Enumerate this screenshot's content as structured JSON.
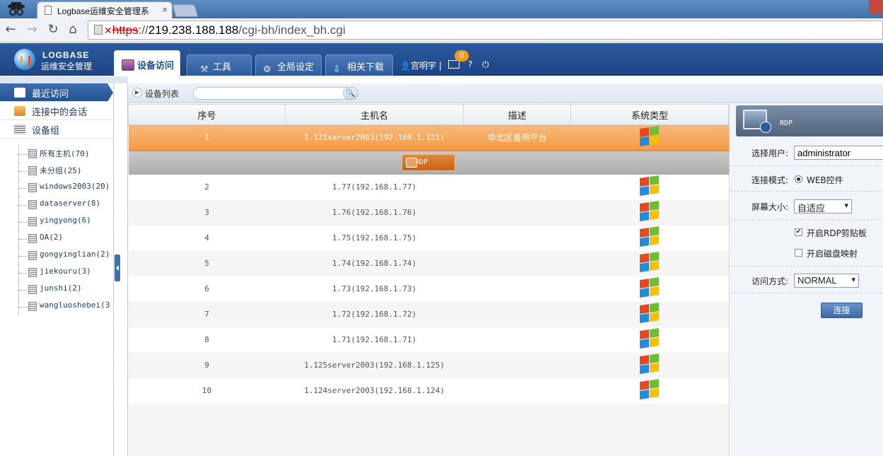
{
  "browser": {
    "tab_title": "Logbase运维安全管理系",
    "url_scheme": "https",
    "url_host": "219.238.188.188",
    "url_path": "/cgi-bh/index_bh.cgi"
  },
  "header": {
    "brand_en": "LOGBASE",
    "brand_cn": "运维安全管理",
    "tabs": [
      {
        "label": "设备访问",
        "icon": "monitor-icon"
      },
      {
        "label": "工具",
        "icon": "tools-icon"
      },
      {
        "label": "全局设定",
        "icon": "settings-icon"
      },
      {
        "label": "相关下载",
        "icon": "download-icon"
      }
    ],
    "user": "宫明宇",
    "separator": "|",
    "mail_badge": "0",
    "help": "?",
    "power": "⏻"
  },
  "sidebar": {
    "items": [
      {
        "label": "最近访问"
      },
      {
        "label": "连接中的会话"
      },
      {
        "label": "设备组"
      }
    ],
    "tree": [
      {
        "label": "所有主机(70)"
      },
      {
        "label": "未分组(25)"
      },
      {
        "label": "windows2003(20)"
      },
      {
        "label": "dataserver(8)"
      },
      {
        "label": "yingyong(6)"
      },
      {
        "label": "OA(2)"
      },
      {
        "label": "gongyinglian(2)"
      },
      {
        "label": "jiekouru(3)"
      },
      {
        "label": "junshi(2)"
      },
      {
        "label": "wangluoshebei(3"
      }
    ]
  },
  "main": {
    "breadcrumb": "设备列表",
    "search_placeholder": "",
    "columns": [
      "序号",
      "主机名",
      "描述",
      "系统类型"
    ],
    "rows": [
      {
        "no": "1",
        "host": "1.121server2003(192.168.1.121)",
        "desc": "华北区备用平台"
      },
      {
        "no": "2",
        "host": "1.77(192.168.1.77)",
        "desc": ""
      },
      {
        "no": "3",
        "host": "1.76(192.168.1.76)",
        "desc": ""
      },
      {
        "no": "4",
        "host": "1.75(192.168.1.75)",
        "desc": ""
      },
      {
        "no": "5",
        "host": "1.74(192.168.1.74)",
        "desc": ""
      },
      {
        "no": "6",
        "host": "1.73(192.168.1.73)",
        "desc": ""
      },
      {
        "no": "7",
        "host": "1.72(192.168.1.72)",
        "desc": ""
      },
      {
        "no": "8",
        "host": "1.71(192.168.1.71)",
        "desc": ""
      },
      {
        "no": "9",
        "host": "1.125server2003(192.168.1.125)",
        "desc": ""
      },
      {
        "no": "10",
        "host": "1.124server2003(192.168.1.124)",
        "desc": ""
      }
    ],
    "action_button": "RDP"
  },
  "panel": {
    "title": "RDP",
    "user_label": "选择用户:",
    "user_value": "administrator",
    "mode_label": "连接模式:",
    "mode_value": "WEB控件",
    "screen_label": "屏幕大小:",
    "screen_value": "自适应",
    "clipboard_label": "开启RDP剪贴板",
    "clipboard_checked": true,
    "disk_label": "开启磁盘映射",
    "disk_checked": false,
    "access_label": "访问方式:",
    "access_value": "NORMAL",
    "connect_label": "连接"
  }
}
